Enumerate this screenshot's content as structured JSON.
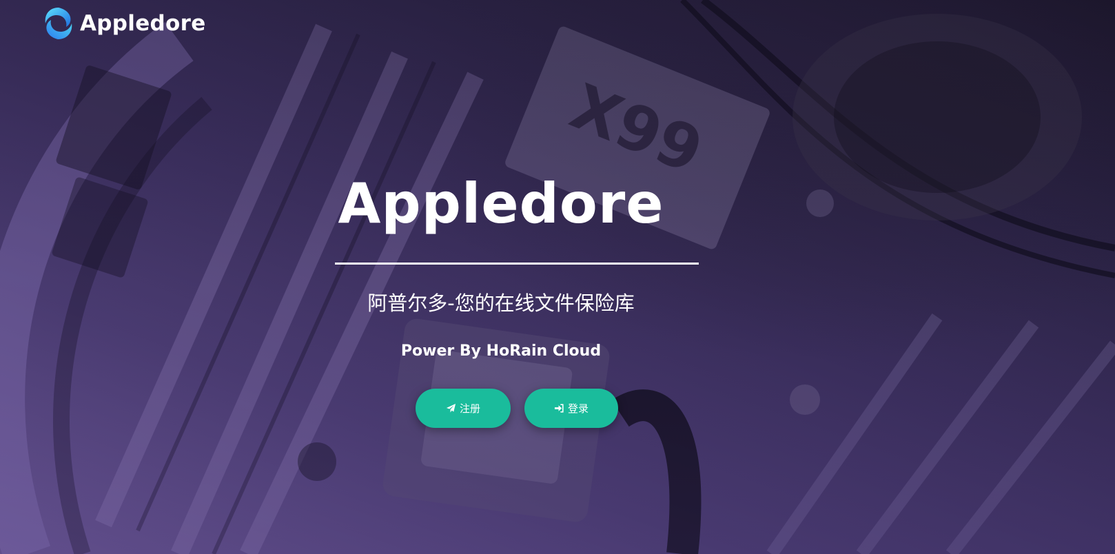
{
  "brand": {
    "name": "Appledore",
    "logo_icon": "appledore-logo-icon"
  },
  "hero": {
    "title": "Appledore",
    "subtitle": "阿普尔多-您的在线文件保险库",
    "powered_by": "Power By HoRain Cloud"
  },
  "actions": {
    "register": {
      "label": "注册",
      "icon": "paper-plane-icon"
    },
    "login": {
      "label": "登录",
      "icon": "sign-in-icon"
    }
  },
  "colors": {
    "button": "#1abc9c",
    "text": "#ffffff",
    "background_overlay": "#3a2e5c"
  }
}
